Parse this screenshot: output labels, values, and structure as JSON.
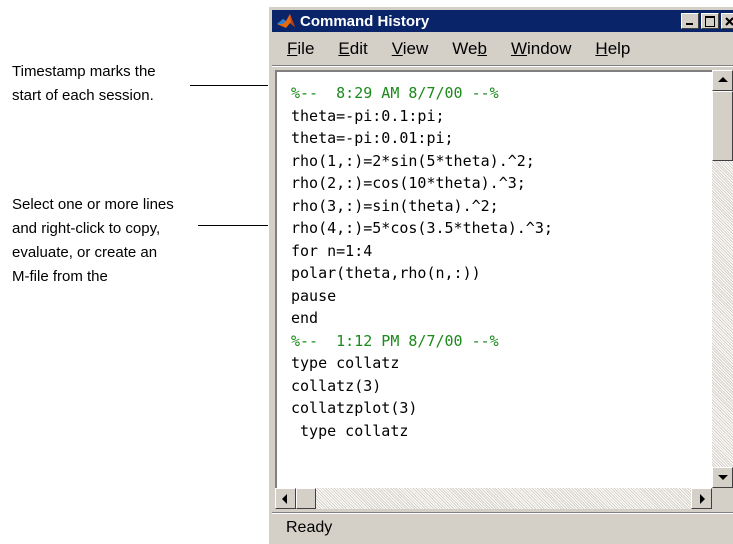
{
  "callouts": {
    "timestamp": [
      "Timestamp marks the",
      "start of each session."
    ],
    "select": [
      "Select one or more lines",
      "and right-click to copy,",
      "evaluate, or create an",
      "M-file from the"
    ]
  },
  "window": {
    "title": "Command History",
    "buttons": {
      "minimize": "minimize-icon",
      "maximize": "maximize-icon",
      "close": "close-icon"
    }
  },
  "menu": [
    {
      "label": "File",
      "underline": "F",
      "rest": "ile"
    },
    {
      "label": "Edit",
      "underline": "E",
      "rest": "dit"
    },
    {
      "label": "View",
      "underline": "V",
      "rest": "iew"
    },
    {
      "label": "Web",
      "pre": "We",
      "underline": "b",
      "rest": ""
    },
    {
      "label": "Window",
      "underline": "W",
      "rest": "indow"
    },
    {
      "label": "Help",
      "underline": "H",
      "rest": "elp"
    }
  ],
  "history": [
    {
      "text": "%--  8:29 AM 8/7/00 --%",
      "timestamp": true
    },
    {
      "text": "theta=-pi:0.1:pi;"
    },
    {
      "text": "theta=-pi:0.01:pi;"
    },
    {
      "text": "rho(1,:)=2*sin(5*theta).^2;"
    },
    {
      "text": "rho(2,:)=cos(10*theta).^3;"
    },
    {
      "text": "rho(3,:)=sin(theta).^2;"
    },
    {
      "text": "rho(4,:)=5*cos(3.5*theta).^3;"
    },
    {
      "text": "for n=1:4"
    },
    {
      "text": "polar(theta,rho(n,:))"
    },
    {
      "text": "pause"
    },
    {
      "text": "end"
    },
    {
      "text": "%--  1:12 PM 8/7/00 --%",
      "timestamp": true
    },
    {
      "text": "type collatz"
    },
    {
      "text": "collatz(3)"
    },
    {
      "text": "collatzplot(3)"
    },
    {
      "text": " type collatz"
    }
  ],
  "status": "Ready",
  "colors": {
    "titlebar": "#0a246a",
    "timestamp": "#1a8a1a",
    "chrome": "#d4d0c8"
  },
  "icons": {
    "app": "matlab-logo-icon"
  }
}
